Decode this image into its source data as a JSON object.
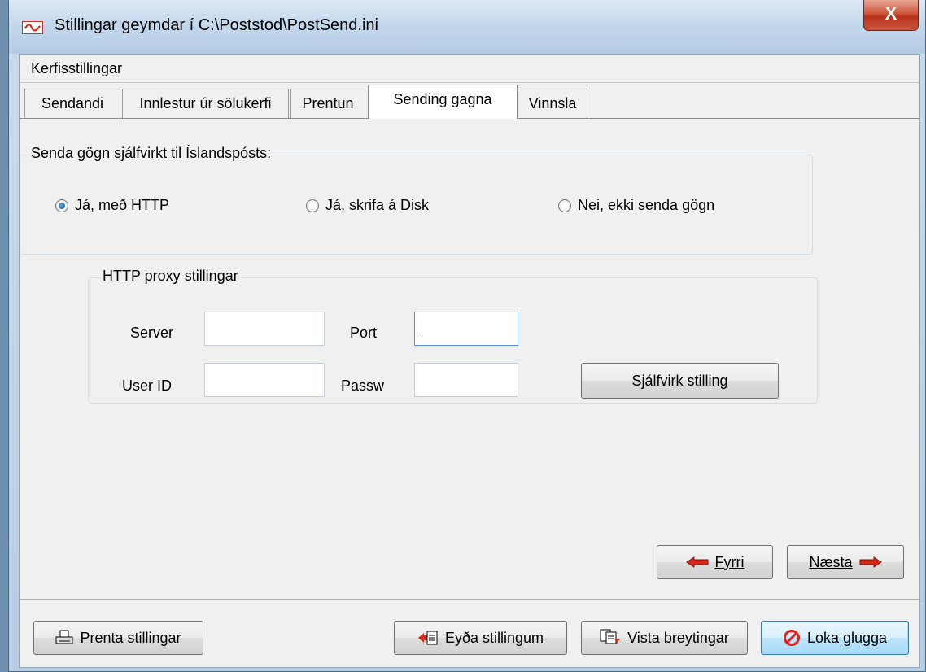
{
  "window": {
    "title": "Stillingar geymdar í C:\\Poststod\\PostSend.ini",
    "close_label": "X"
  },
  "menubar": {
    "label": "Kerfisstillingar"
  },
  "tabs": [
    {
      "label": "Sendandi"
    },
    {
      "label": "Innlestur úr sölukerfi"
    },
    {
      "label": "Prentun"
    },
    {
      "label": "Sending gagna",
      "active": true
    },
    {
      "label": "Vinnsla"
    }
  ],
  "send_group": {
    "label": "Senda gögn sjálfvirkt til Íslandspósts:",
    "options": [
      {
        "label": "Já, með HTTP",
        "selected": true
      },
      {
        "label": "Já, skrifa á Disk",
        "selected": false
      },
      {
        "label": "Nei, ekki senda gögn",
        "selected": false
      }
    ]
  },
  "proxy_group": {
    "label": "HTTP proxy stillingar",
    "server_label": "Server",
    "server_value": "",
    "port_label": "Port",
    "port_value": "",
    "userid_label": "User ID",
    "userid_value": "",
    "passw_label": "Passw",
    "passw_value": "",
    "auto_button": "Sjálfvirk stilling"
  },
  "nav": {
    "prev_label": "Fyrri",
    "next_label": "Næsta"
  },
  "footer": {
    "print_label": "Prenta stillingar",
    "delete_label": "Eyða stillingum",
    "save_label": "Vista breytingar",
    "close_label": "Loka glugga"
  },
  "colors": {
    "arrow_red": "#d42a1a",
    "close_icon_red": "#e0201a",
    "radio_selected": "#1a4f8c"
  }
}
